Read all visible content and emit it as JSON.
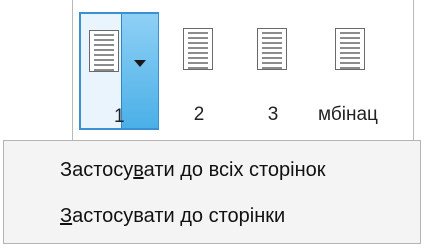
{
  "gallery": {
    "tiles": [
      {
        "label": "1"
      },
      {
        "label": "2"
      },
      {
        "label": "3"
      },
      {
        "label": "мбінац"
      }
    ],
    "accent_color": "#3b8fd3"
  },
  "menu": {
    "items": [
      {
        "pre": "Застосу",
        "mnemonic": "в",
        "post": "ати до всіх сторінок"
      },
      {
        "pre": "",
        "mnemonic": "З",
        "post": "астосувати до сторінки"
      }
    ]
  }
}
